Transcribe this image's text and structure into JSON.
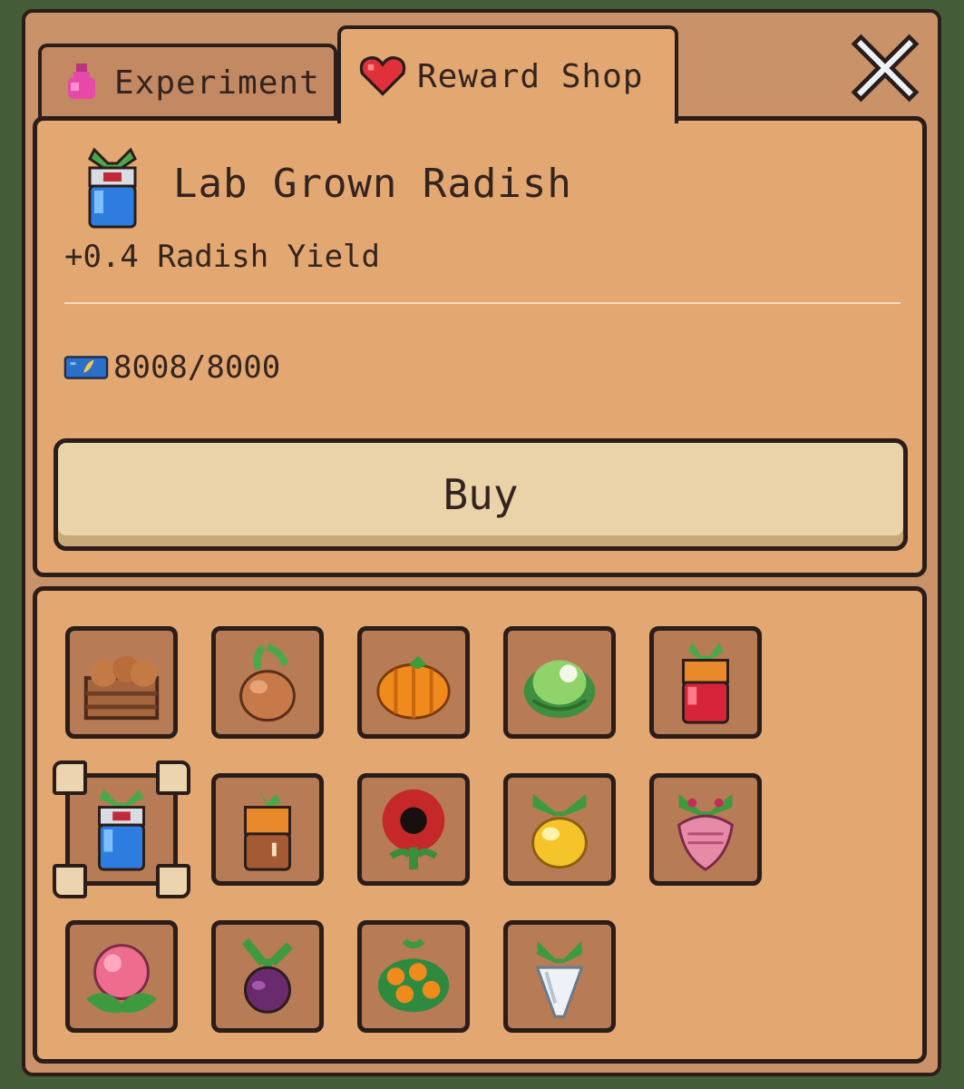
{
  "tabs": [
    {
      "label": "Experiment",
      "icon": "flask-icon",
      "active": false
    },
    {
      "label": "Reward Shop",
      "icon": "heart-icon",
      "active": true
    }
  ],
  "close": {
    "icon": "close-icon"
  },
  "selected_item": {
    "title": "Lab Grown Radish",
    "description": "+0.4 Radish Yield",
    "cost": "8008/8000",
    "currency_icon": "seed-ticket-icon",
    "buy_label": "Buy"
  },
  "grid_items": [
    {
      "name": "crate-of-potatoes"
    },
    {
      "name": "onion"
    },
    {
      "name": "pumpkin"
    },
    {
      "name": "cabbage"
    },
    {
      "name": "lab-grown-carrot-jar"
    },
    {
      "name": "lab-grown-radish",
      "selected": true
    },
    {
      "name": "lab-grown-pumpkin-jar"
    },
    {
      "name": "red-sunflower"
    },
    {
      "name": "golden-turnip"
    },
    {
      "name": "pink-beet"
    },
    {
      "name": "pink-flower-bud"
    },
    {
      "name": "purple-beet"
    },
    {
      "name": "orange-berry-bush"
    },
    {
      "name": "white-radish"
    }
  ],
  "colors": {
    "panel": "#e3a771",
    "window": "#c99268",
    "outline": "#2a1d1a",
    "button": "#ead3a9",
    "text": "#33241f"
  }
}
